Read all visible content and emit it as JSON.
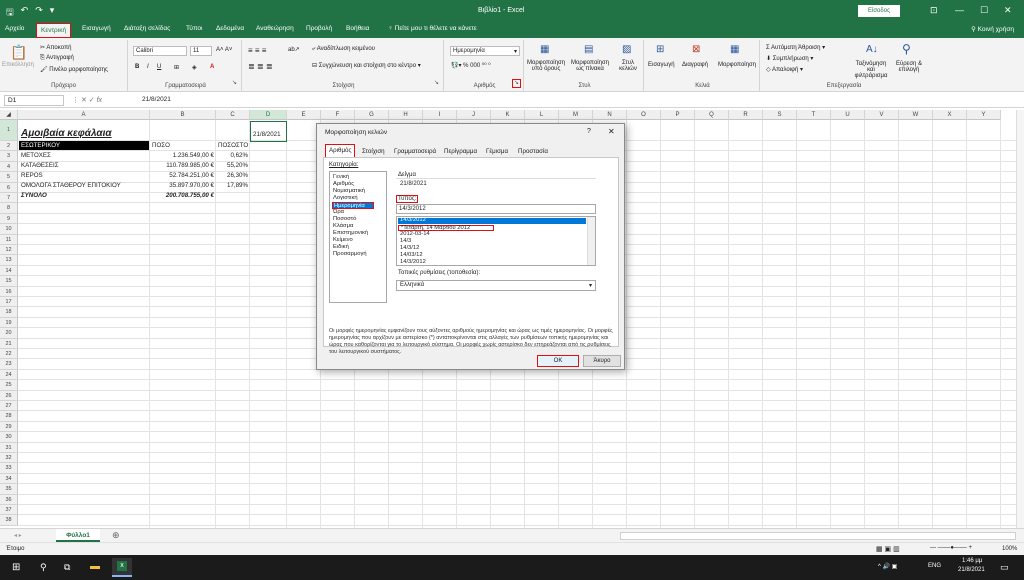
{
  "titlebar": {
    "qat": [
      "🖫",
      "↶",
      "↷",
      "▾"
    ],
    "document_title": "Βιβλίο1 - Excel",
    "signin": "Είσοδος",
    "window_controls": [
      "⊡",
      "—",
      "☐",
      "✕"
    ]
  },
  "tabs": [
    {
      "label": "Αρχείο"
    },
    {
      "label": "Κεντρική"
    },
    {
      "label": "Εισαγωγή"
    },
    {
      "label": "Διάταξη σελίδας"
    },
    {
      "label": "Τύποι"
    },
    {
      "label": "Δεδομένα"
    },
    {
      "label": "Αναθεώρηση"
    },
    {
      "label": "Προβολή"
    },
    {
      "label": "Βοήθεια"
    },
    {
      "label": "Πείτε μου τι θέλετε να κάνετε"
    }
  ],
  "share_label": "Κοινή χρήση",
  "ribbon": {
    "clipboard": {
      "cut": "Αποκοπή",
      "copy": "Αντιγραφή",
      "format_painter": "Πινέλο μορφοποίησης",
      "paste": "Επικόλληση",
      "group": "Πρόχειρο"
    },
    "font": {
      "name": "Calibri",
      "size": "11",
      "group": "Γραμματοσειρά"
    },
    "alignment": {
      "wrap": "Αναδίπλωση κειμένου",
      "merge": "Συγχώνευση και στοίχιση στο κέντρο",
      "group": "Στοίχιση"
    },
    "number": {
      "format": "Ημερομηνία",
      "group": "Αριθμός"
    },
    "styles": {
      "conditional": "Μορφοποίηση υπό όρους",
      "table": "Μορφοποίηση ως πίνακα",
      "cell": "Στυλ κελιών",
      "group": "Στυλ"
    },
    "cells": {
      "insert": "Εισαγωγή",
      "delete": "Διαγραφή",
      "format": "Μορφοποίηση",
      "group": "Κελιά"
    },
    "editing": {
      "autosum": "Αυτόματη Άθροιση",
      "fill": "Συμπλήρωση",
      "clear": "Απαλοιφή",
      "sort": "Ταξινόμηση και φιλτράρισμα",
      "find": "Εύρεση & επιλογή",
      "group": "Επεξεργασία"
    }
  },
  "formula_bar": {
    "name_box": "D1",
    "fx": "fx",
    "value": "21/8/2021"
  },
  "columns": [
    "A",
    "B",
    "C",
    "D",
    "E",
    "F",
    "G",
    "H",
    "I",
    "J",
    "K",
    "L",
    "M",
    "N",
    "O",
    "P",
    "Q",
    "R",
    "S",
    "T",
    "U",
    "V",
    "W",
    "X",
    "Y"
  ],
  "rows": [
    "1",
    "2",
    "3",
    "4",
    "5",
    "6",
    "7",
    "8",
    "9",
    "10",
    "11",
    "12",
    "13",
    "14",
    "15",
    "16",
    "17",
    "18",
    "19",
    "20",
    "21",
    "22",
    "23",
    "24",
    "25",
    "26",
    "27",
    "28",
    "29",
    "30",
    "31",
    "32",
    "33",
    "34",
    "35",
    "36",
    "37",
    "38"
  ],
  "sheet": {
    "title": "Αμοιβαία κεφάλαια",
    "d1": "21/8/2021",
    "header": [
      "ΕΣΩΤΕΡΙΚΟΥ",
      "ΠΟΣΟ",
      "ΠΟΣΟΣΤΟ"
    ],
    "rows": [
      [
        "ΜΕΤΟΧΕΣ",
        "1.236.549,00 €",
        "0,62%"
      ],
      [
        "ΚΑΤΑΘΕΣΕΙΣ",
        "110.789.985,00 €",
        "55,20%"
      ],
      [
        "REPOS",
        "52.784.251,00 €",
        "26,30%"
      ],
      [
        "ΟΜΟΛΟΓΑ ΣΤΑΘΕΡΟΥ ΕΠΙΤΟΚΙΟΥ",
        "35.897.970,00 €",
        "17,89%"
      ]
    ],
    "total": [
      "ΣΥΝΟΛΟ",
      "200.708.755,00 €"
    ]
  },
  "sheet_tab": "Φύλλο1",
  "add_sheet": "⊕",
  "status": {
    "ready": "Έτοιμο",
    "zoom": "100%"
  },
  "taskbar": {
    "time": "1:46 μμ",
    "date": "21/8/2021",
    "lang": "ENG"
  },
  "dialog": {
    "title": "Μορφοποίηση κελιών",
    "help": "?",
    "close": "✕",
    "tabs": [
      "Αριθμός",
      "Στοίχιση",
      "Γραμματοσειρά",
      "Περίγραμμα",
      "Γέμισμα",
      "Προστασία"
    ],
    "category_label": "Κατηγορία:",
    "categories": [
      "Γενική",
      "Αριθμός",
      "Νομισματική",
      "Λογιστική",
      "Ημερομηνία",
      "Ώρα",
      "Ποσοστό",
      "Κλάσμα",
      "Επιστημονική",
      "Κείμενο",
      "Ειδική",
      "Προσαρμογή"
    ],
    "selected_category": "Ημερομηνία",
    "sample_label": "Δείγμα",
    "sample_value": "21/8/2021",
    "type_label": "Τύπος:",
    "types": [
      "14/3/2012",
      "*Τετάρτη, 14 Μαρτίου 2012",
      "2012-03-14",
      "14/3",
      "14/3/12",
      "14/03/12",
      "14/3/2012"
    ],
    "locale_label": "Τοπικές ρυθμίσεις (τοποθεσία):",
    "locale_value": "Ελληνικά",
    "description": "Οι μορφές ημερομηνίας εμφανίζουν τους αύξοντες αριθμούς ημερομηνίας και ώρας ως τιμές ημερομηνίας. Οι μορφές ημερομηνίας που αρχίζουν με αστερίσκο (*) ανταποκρίνονται στις αλλαγές των ρυθμίσεων τοπικής ημερομηνίας και ώρας που καθορίζονται για το λειτουργικό σύστημα. Οι μορφές χωρίς αστερίσκο δεν επηρεάζονται από τις ρυθμίσεις του λειτουργικού συστήματος.",
    "ok": "OK",
    "cancel": "Άκυρο"
  }
}
